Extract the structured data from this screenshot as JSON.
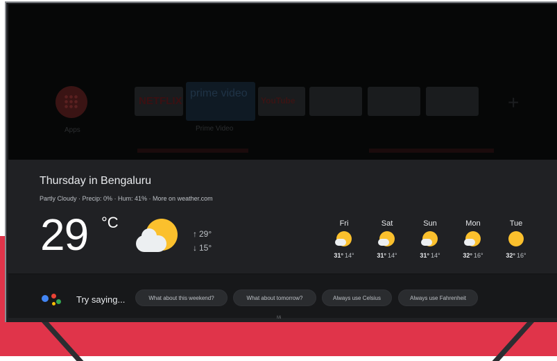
{
  "home_row": {
    "apps_label": "Apps",
    "tiles": [
      {
        "name": "netflix",
        "text": "NETFLIX",
        "color": "#8e1a1f"
      },
      {
        "name": "prime-video",
        "text": "prime video",
        "color": "#1b3a55",
        "label": "Prime Video"
      },
      {
        "name": "youtube",
        "text": "YouTube",
        "color": "#6a1a1a"
      }
    ]
  },
  "weather": {
    "title": "Thursday in Bengaluru",
    "details": "Partly Cloudy · Precip: 0% · Hum: 41% · More on weather.com",
    "temperature": "29",
    "unit": "°C",
    "high": "29°",
    "low": "15°",
    "high_arrow": "↑",
    "low_arrow": "↓",
    "icon": "partly-cloudy-icon",
    "forecast": [
      {
        "day": "Fri",
        "high": "31°",
        "low": "14°",
        "icon": "partly-cloudy-icon"
      },
      {
        "day": "Sat",
        "high": "31°",
        "low": "14°",
        "icon": "partly-cloudy-icon"
      },
      {
        "day": "Sun",
        "high": "31°",
        "low": "14°",
        "icon": "partly-cloudy-icon"
      },
      {
        "day": "Mon",
        "high": "32°",
        "low": "16°",
        "icon": "partly-cloudy-icon"
      },
      {
        "day": "Tue",
        "high": "32°",
        "low": "16°",
        "icon": "sunny-icon"
      }
    ]
  },
  "assistant": {
    "try_label": "Try saying...",
    "suggestions": [
      "What about this weekend?",
      "What about tomorrow?",
      "Always use Celsius",
      "Always use Fahrenheit"
    ]
  },
  "tv": {
    "brand": "Mi"
  },
  "colors": {
    "accent_red": "#e0344a",
    "card_bg": "#202124",
    "sun": "#fbc02d",
    "cloud": "#eceff1",
    "ga_blue": "#4285f4",
    "ga_red": "#ea4335",
    "ga_yellow": "#fbbc05",
    "ga_green": "#34a853"
  }
}
